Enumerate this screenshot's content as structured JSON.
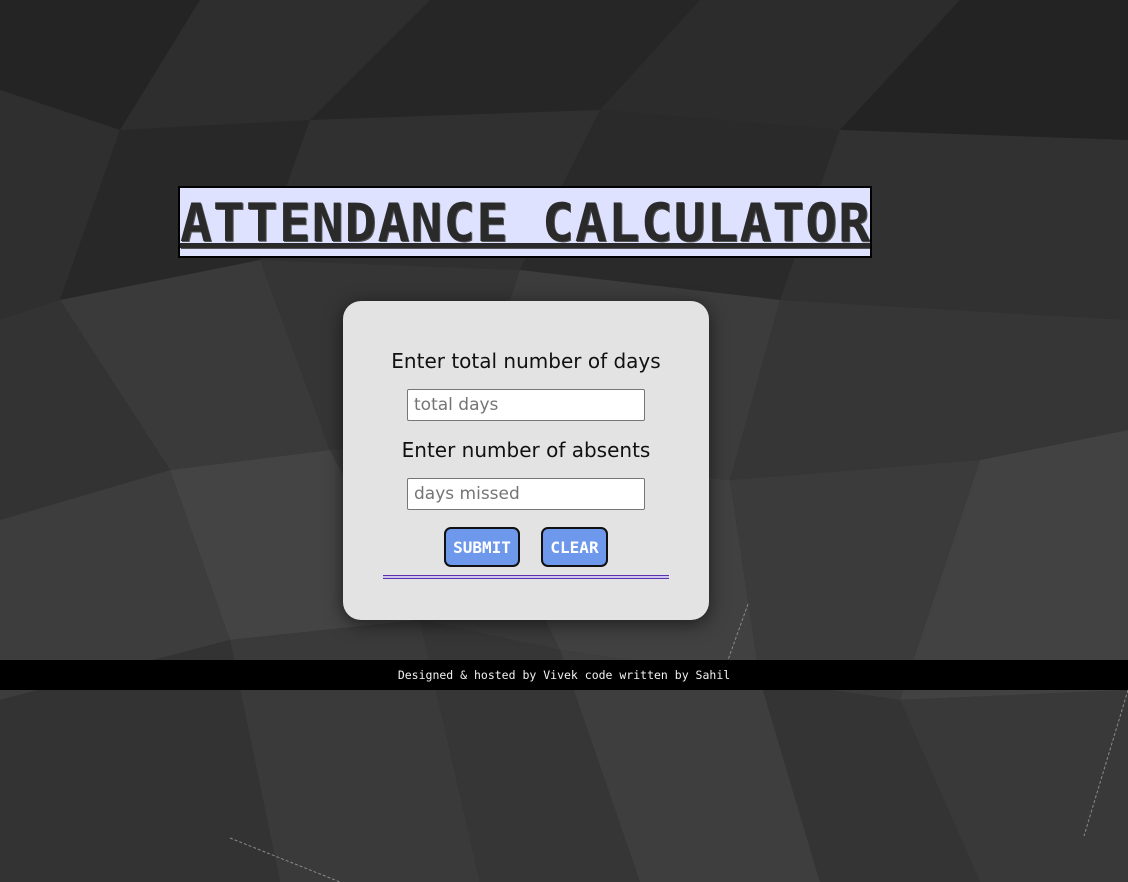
{
  "header": {
    "title": "ATTENDANCE CALCULATOR"
  },
  "form": {
    "total_label": "Enter total number of days",
    "total_placeholder": "total days",
    "absent_label": "Enter number of absents",
    "absent_placeholder": "days missed",
    "submit_label": "SUBMIT",
    "clear_label": "CLEAR"
  },
  "footer": {
    "text": "Designed & hosted by Vivek code written by Sahil"
  },
  "colors": {
    "background": "#2b2b2b",
    "title_bg": "#dfe2ff",
    "card_bg": "#e3e3e3",
    "button_bg": "#6e98ec",
    "divider": "#5a2fb0",
    "footer_bg": "#000000"
  }
}
